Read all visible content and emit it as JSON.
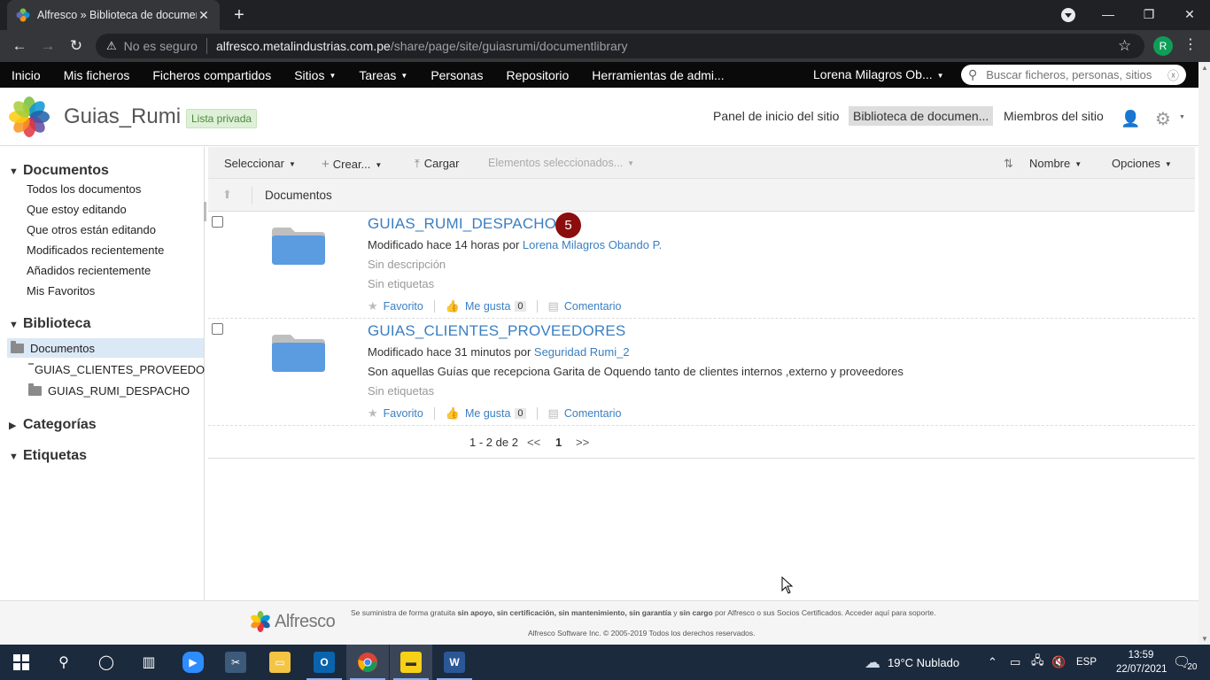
{
  "browser": {
    "tab_title": "Alfresco » Biblioteca de documen",
    "tab_close": "✕",
    "new_tab": "+",
    "url_warning": "No es seguro",
    "url_host": "alfresco.metalindustrias.com.pe",
    "url_path": "/share/page/site/guiasrumi/documentlibrary",
    "profile_initial": "R"
  },
  "appnav": {
    "items": [
      "Inicio",
      "Mis ficheros",
      "Ficheros compartidos",
      "Sitios",
      "Tareas",
      "Personas",
      "Repositorio",
      "Herramientas de admi..."
    ],
    "user": "Lorena Milagros Ob...",
    "search_placeholder": "Buscar ficheros, personas, sitios"
  },
  "site": {
    "title": "Guias_Rumi",
    "visibility": "Lista privada",
    "nav": [
      "Panel de inicio del sitio",
      "Biblioteca de documen...",
      "Miembros del sitio"
    ]
  },
  "sidebar": {
    "documents_header": "Documentos",
    "filters": [
      "Todos los documentos",
      "Que estoy editando",
      "Que otros están editando",
      "Modificados recientemente",
      "Añadidos recientemente",
      "Mis Favoritos"
    ],
    "library_header": "Biblioteca",
    "tree_root": "Documentos",
    "tree_children": [
      "GUIAS_CLIENTES_PROVEEDORES",
      "GUIAS_RUMI_DESPACHO"
    ],
    "categories_header": "Categorías",
    "tags_header": "Etiquetas"
  },
  "actions": {
    "select": "Seleccionar",
    "create": "Crear...",
    "upload": "Cargar",
    "selected_items": "Elementos seleccionados...",
    "sort": "Nombre",
    "options": "Opciones"
  },
  "breadcrumb": "Documentos",
  "items": [
    {
      "name": "GUIAS_RUMI_DESPACHO",
      "modified_prefix": "Modificado hace 14 horas por",
      "modified_by": "Lorena Milagros Obando P.",
      "description": "Sin descripción",
      "tags": "Sin etiquetas",
      "favorite": "Favorito",
      "like": "Me gusta",
      "like_count": "0",
      "comment": "Comentario"
    },
    {
      "name": "GUIAS_CLIENTES_PROVEEDORES",
      "modified_prefix": "Modificado hace 31 minutos por",
      "modified_by": "Seguridad Rumi_2",
      "description": "Son aquellas Guías que recepciona Garita de Oquendo tanto de clientes internos ,externo y proveedores",
      "tags": "Sin etiquetas",
      "favorite": "Favorito",
      "like": "Me gusta",
      "like_count": "0",
      "comment": "Comentario"
    }
  ],
  "badge_count": "5",
  "pager": {
    "range": "1 - 2 de 2",
    "prev": "<<",
    "page": "1",
    "next": ">>"
  },
  "footer": {
    "logo_text": "Alfresco",
    "line1_a": "Se suministra de forma gratuita ",
    "line1_b": "sin apoyo, sin certificación, sin mantenimiento, sin garantía",
    "line1_c": "y ",
    "line1_d": "sin cargo",
    "line1_e": " por Alfresco o sus ",
    "line1_f": "Socios Certificados",
    "line1_g": ". ",
    "line1_h": "Acceder aquí para soporte.",
    "line2": "Alfresco Software Inc. © 2005-2019 Todos los derechos reservados."
  },
  "taskbar": {
    "weather": "19°C  Nublado",
    "lang": "ESP",
    "time": "13:59",
    "date": "22/07/2021",
    "notifications": "20"
  }
}
